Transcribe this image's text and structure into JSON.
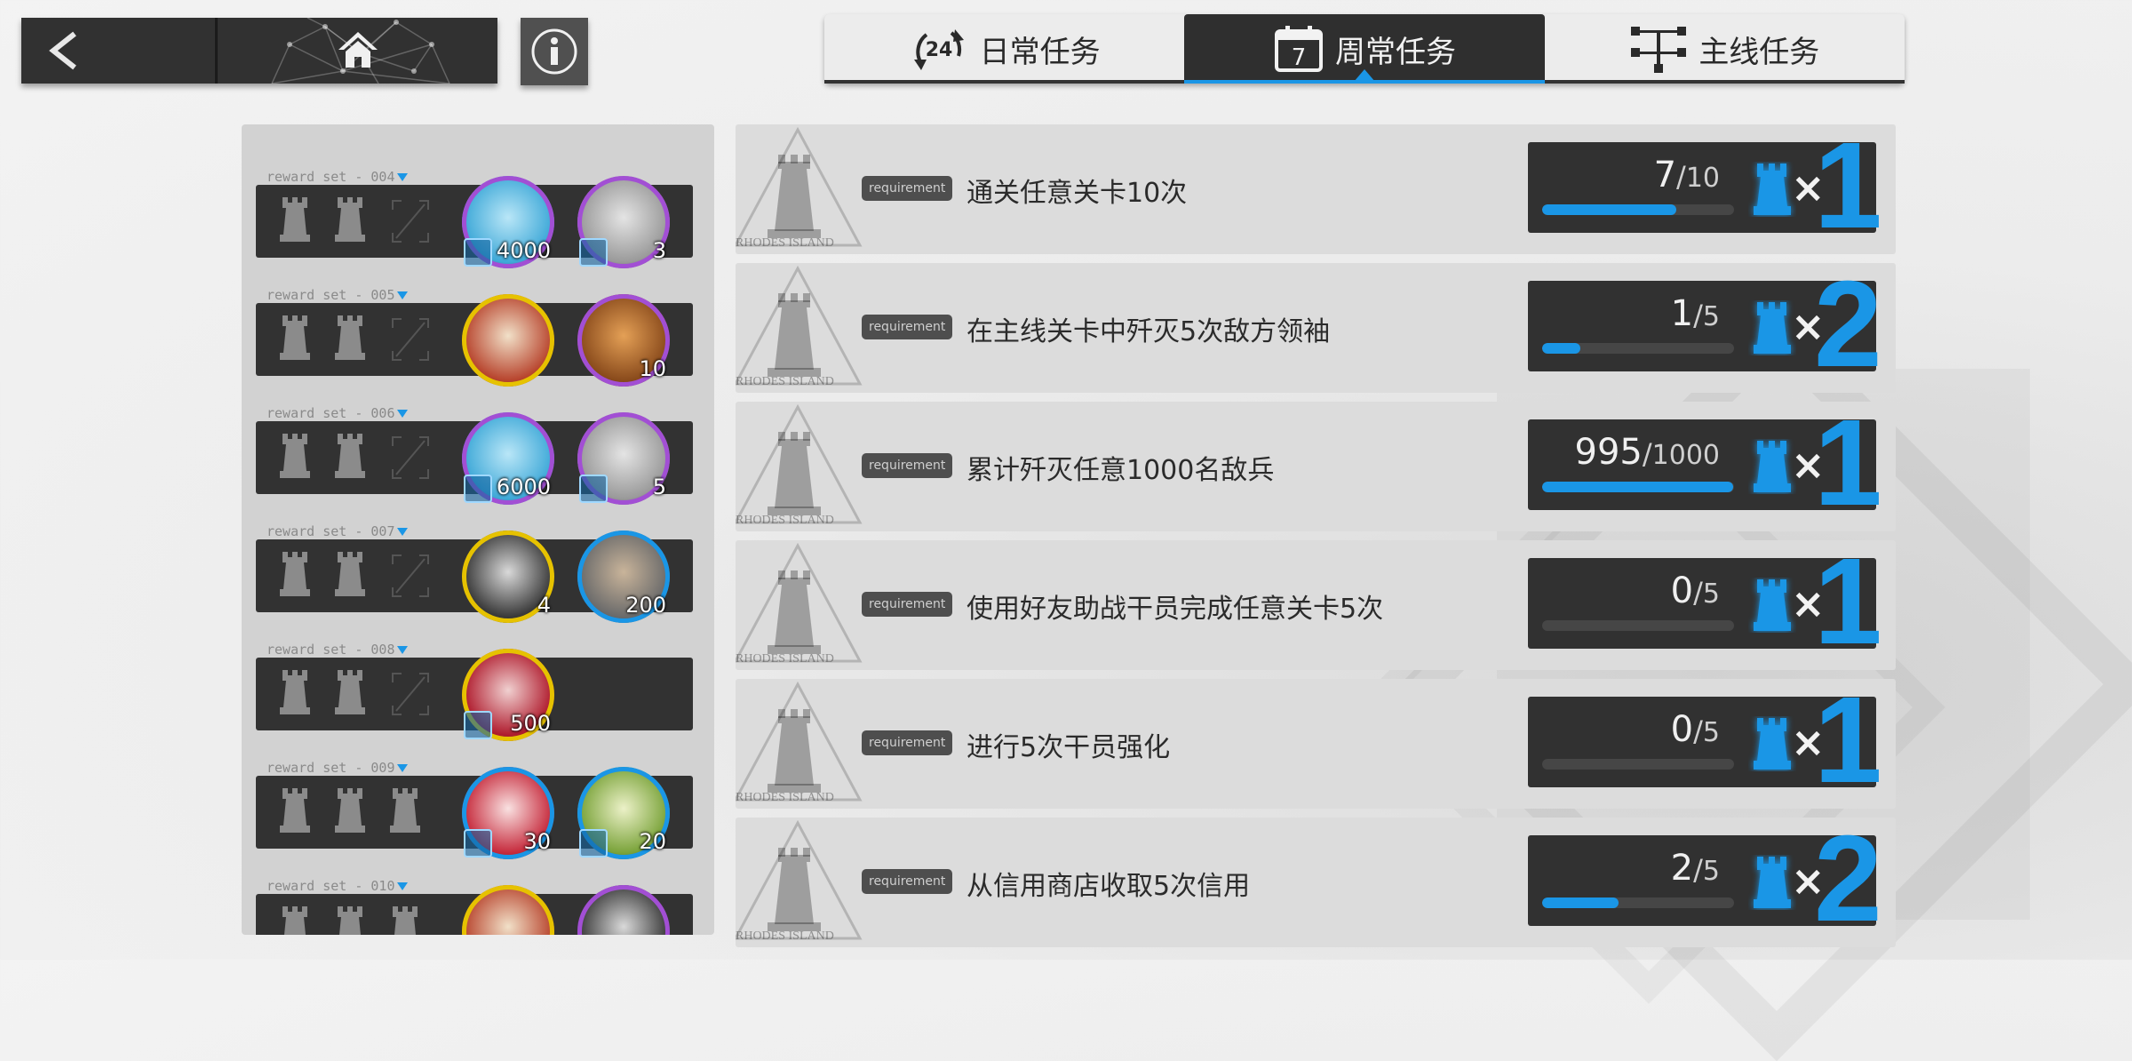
{
  "header": {
    "back_icon": "chevron-left-icon",
    "home_icon": "home-icon",
    "info_icon": "info-icon"
  },
  "tabs": [
    {
      "label": "日常任务",
      "icon": "clock-24-icon",
      "icon_text": "24",
      "active": false
    },
    {
      "label": "周常任务",
      "icon": "calendar-icon",
      "icon_text": "7",
      "active": true
    },
    {
      "label": "主线任务",
      "icon": "tree-icon",
      "active": false
    }
  ],
  "reward_sets": [
    {
      "label": "reward  set - 004",
      "slots": 3,
      "filled": 2,
      "items": [
        {
          "name": "lmd-ticket",
          "count": "4000",
          "ring": "#a24fd4",
          "sub": "ticket-icon"
        },
        {
          "name": "silver-block",
          "count": "3",
          "ring": "#a24fd4",
          "sub": "card-icon"
        }
      ]
    },
    {
      "label": "reward  set - 005",
      "slots": 3,
      "filled": 2,
      "items": [
        {
          "name": "battle-record",
          "count": "",
          "ring": "#e6c200"
        },
        {
          "name": "copper-bar",
          "count": "10",
          "ring": "#a24fd4"
        }
      ]
    },
    {
      "label": "reward  set - 006",
      "slots": 3,
      "filled": 2,
      "items": [
        {
          "name": "lmd-ticket",
          "count": "6000",
          "ring": "#a24fd4",
          "sub": "ticket-icon"
        },
        {
          "name": "silver-block",
          "count": "5",
          "ring": "#a24fd4",
          "sub": "card-icon"
        }
      ]
    },
    {
      "label": "reward  set - 007",
      "slots": 3,
      "filled": 2,
      "items": [
        {
          "name": "exp-card",
          "count": "4",
          "ring": "#e6c200"
        },
        {
          "name": "nut-bolt",
          "count": "200",
          "ring": "#1a96e6"
        }
      ]
    },
    {
      "label": "reward  set - 008",
      "slots": 3,
      "filled": 2,
      "items": [
        {
          "name": "red-device",
          "count": "500",
          "ring": "#e6c200",
          "sub": "diamond-icon"
        }
      ]
    },
    {
      "label": "reward  set - 009",
      "slots": 3,
      "filled": 3,
      "items": [
        {
          "name": "purchase-voucher",
          "count": "30",
          "ring": "#1a96e6",
          "sub": "crate-icon"
        },
        {
          "name": "recruit-permit",
          "count": "20",
          "ring": "#1a96e6",
          "sub": "document-icon"
        }
      ]
    },
    {
      "label": "reward  set - 010",
      "slots": 3,
      "filled": 3,
      "items": [
        {
          "name": "battle-record",
          "count": "",
          "ring": "#e6c200"
        },
        {
          "name": "exp-card",
          "count": "",
          "ring": "#a24fd4"
        }
      ]
    }
  ],
  "tasks": [
    {
      "badge": "requirement",
      "desc": "通关任意关卡10次",
      "current": "7",
      "total": "10",
      "progress": 0.7,
      "reward": "1",
      "logo_text": "RHODES ISLAND"
    },
    {
      "badge": "requirement",
      "desc": "在主线关卡中歼灭5次敌方领袖",
      "current": "1",
      "total": "5",
      "progress": 0.2,
      "reward": "2",
      "logo_text": "RHODES ISLAND"
    },
    {
      "badge": "requirement",
      "desc": "累计歼灭任意1000名敌兵",
      "current": "995",
      "total": "1000",
      "progress": 0.995,
      "reward": "1",
      "logo_text": "RHODES ISLAND"
    },
    {
      "badge": "requirement",
      "desc": "使用好友助战干员完成任意关卡5次",
      "current": "0",
      "total": "5",
      "progress": 0,
      "reward": "1",
      "logo_text": "RHODES ISLAND"
    },
    {
      "badge": "requirement",
      "desc": "进行5次干员强化",
      "current": "0",
      "total": "5",
      "progress": 0,
      "reward": "1",
      "logo_text": "RHODES ISLAND"
    },
    {
      "badge": "requirement",
      "desc": "从信用商店收取5次信用",
      "current": "2",
      "total": "5",
      "progress": 0.4,
      "reward": "2",
      "logo_text": "RHODES ISLAND"
    }
  ],
  "colors": {
    "accent": "#1a96e6",
    "panel_dark": "#313131",
    "panel_light": "#dcdcdc"
  }
}
